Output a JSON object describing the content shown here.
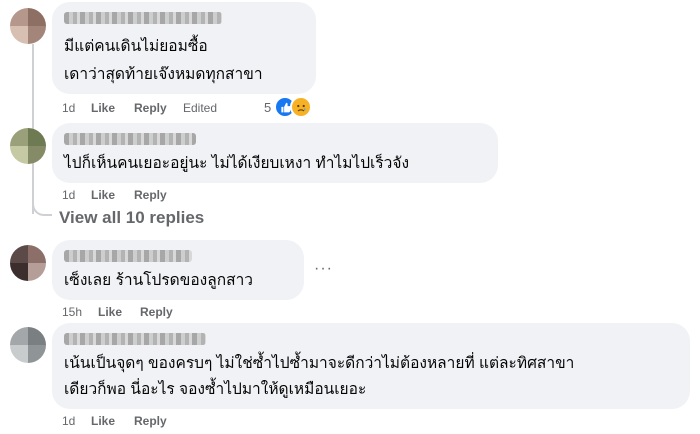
{
  "comments": [
    {
      "text_lines": [
        "มีแต่คนเดินไม่ยอมซื้อ",
        "เดาว่าสุดท้ายเจ๊งหมดทุกสาขา"
      ],
      "time": "1d",
      "like_label": "Like",
      "reply_label": "Reply",
      "edited_label": "Edited",
      "reaction_count": "5",
      "reactions": [
        "like-icon",
        "sad-icon"
      ],
      "avatar_colors": [
        "#b6978b",
        "#8e6f64",
        "#d7bfb2",
        "#a4857a"
      ]
    },
    {
      "text_lines": [
        "ไปก็เห็นคนเยอะอยู่นะ ไม่ได้เงียบเหงา ทำไมไปเร็วจัง"
      ],
      "time": "1d",
      "like_label": "Like",
      "reply_label": "Reply",
      "avatar_colors": [
        "#9aa07a",
        "#6d7a52",
        "#c5c9a4",
        "#848b66"
      ]
    },
    {
      "text_lines": [
        "เซ็งเลย ร้านโปรดของลูกสาว"
      ],
      "time": "15h",
      "like_label": "Like",
      "reply_label": "Reply",
      "avatar_colors": [
        "#5b4a48",
        "#8c6f69",
        "#3c2e2d",
        "#b59e97"
      ]
    },
    {
      "text_lines": [
        "เน้นเป็นจุดๆ ของครบๆ ไม่ใช่ซ้ำไปซ้ำมาจะดีกว่าไม่ต้องหลายที่ แต่ละทิศสาขา",
        "เดียวก็พอ นี่อะไร จองซ้ำไปมาให้ดูเหมือนเยอะ"
      ],
      "time": "1d",
      "like_label": "Like",
      "reply_label": "Reply",
      "avatar_colors": [
        "#a3a7a9",
        "#7a7f82",
        "#c9cccd",
        "#8f9496"
      ]
    }
  ],
  "view_replies_label": "View all 10 replies",
  "more_options_glyph": "···",
  "colors": {
    "bubble": "#f0f2f5",
    "text": "#050505",
    "meta": "#65676b",
    "like_reaction": "#1877f2",
    "sad_reaction": "#f7b125"
  }
}
